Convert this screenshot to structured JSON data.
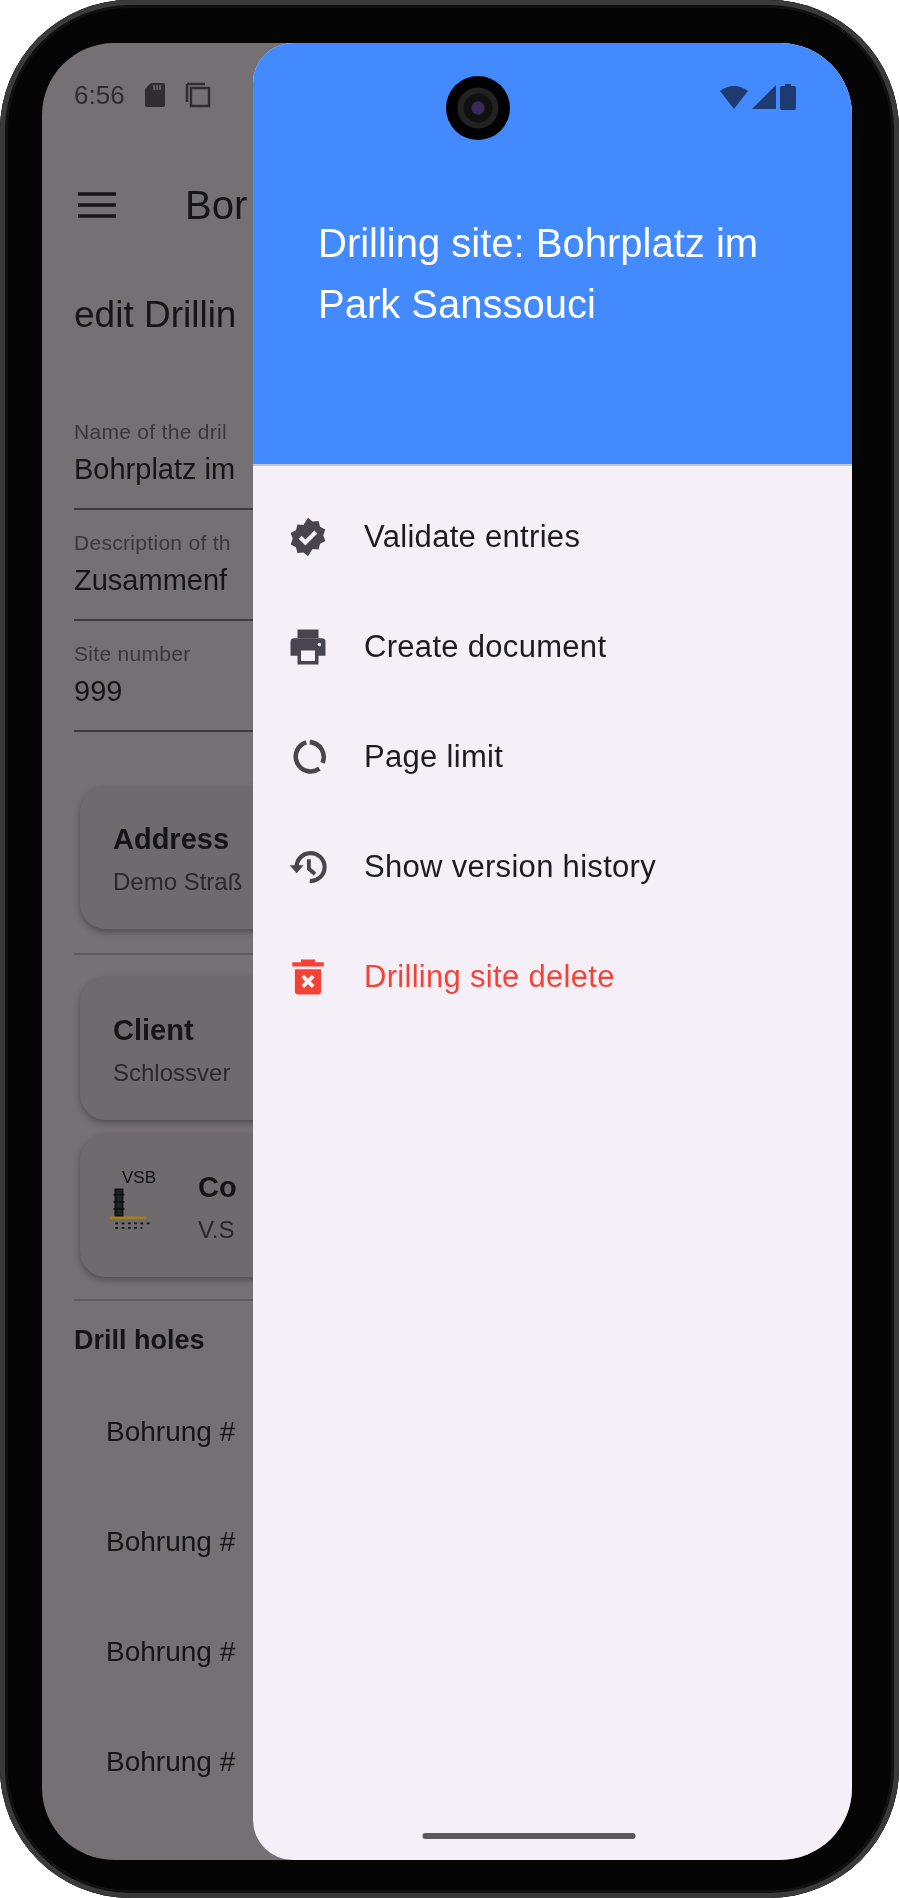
{
  "status_bar": {
    "time": "6:56"
  },
  "app_bar": {
    "title": "Bor"
  },
  "page_title": "edit Drillin",
  "fields": [
    {
      "label": "Name of the dril",
      "value": "Bohrplatz im"
    },
    {
      "label": "Description of th",
      "value": "Zusammenf"
    },
    {
      "label": "Site number",
      "value": "999"
    }
  ],
  "cards": [
    {
      "kind": "text",
      "title": "Address",
      "subtitle": "Demo Straß"
    },
    {
      "kind": "text",
      "title": "Client",
      "subtitle": "Schlossver"
    },
    {
      "kind": "logo",
      "logo_text": "VSB",
      "title": "Co",
      "subtitle": "V.S"
    }
  ],
  "section_title": "Drill holes",
  "holes": [
    "Bohrung #",
    "Bohrung #",
    "Bohrung #",
    "Bohrung #"
  ],
  "drawer": {
    "header": "Drilling site: Bohrplatz im Park Sanssouci",
    "items": [
      {
        "label": "Validate entries",
        "kind": "normal"
      },
      {
        "label": "Create document",
        "kind": "normal"
      },
      {
        "label": "Page limit",
        "kind": "normal"
      },
      {
        "label": "Show version history",
        "kind": "normal"
      },
      {
        "label": "Drilling site delete",
        "kind": "danger"
      }
    ]
  }
}
